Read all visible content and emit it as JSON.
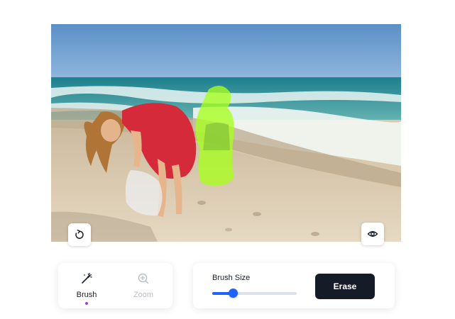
{
  "canvas": {
    "image_alt": "",
    "mask_color": "#a8ff1e"
  },
  "overlay_buttons": {
    "reset_icon": "rotate-icon",
    "preview_icon": "eye-icon"
  },
  "tools": {
    "brush_label": "Brush",
    "brush_icon": "magic-wand-icon",
    "zoom_label": "Zoom",
    "zoom_icon": "zoom-in-icon",
    "active": "Brush",
    "active_dot_color": "#a23fe0"
  },
  "brush_size": {
    "label": "Brush Size",
    "value_fraction": 0.24
  },
  "actions": {
    "erase_label": "Erase"
  },
  "colors": {
    "accent": "#1e63ff",
    "erase_button_bg": "#151b27",
    "muted_text": "#b7bcc6"
  }
}
